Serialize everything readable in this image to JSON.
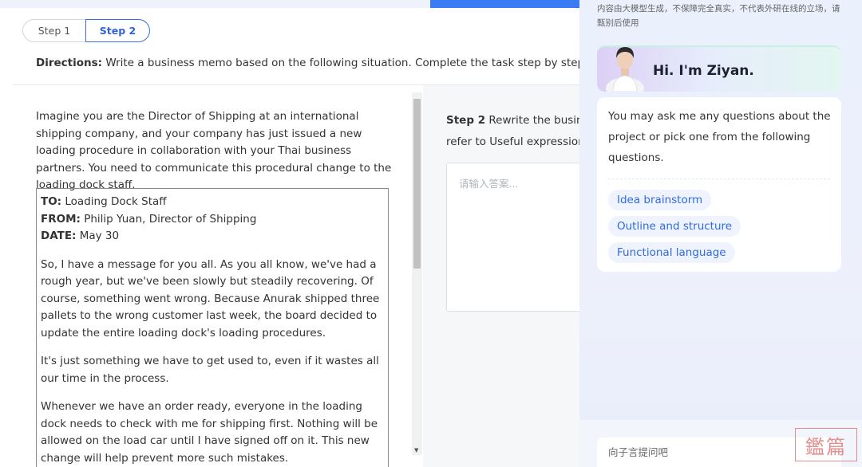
{
  "steps": {
    "tabs": [
      {
        "label": "Step 1"
      },
      {
        "label": "Step 2"
      }
    ]
  },
  "directions": {
    "label": "Directions:",
    "text": "Write a business memo based on the following situation. Complete the task step by step."
  },
  "situation": {
    "intro": "Imagine you are the Director of Shipping at an international shipping company, and your company has just issued a new loading procedure in collaboration with your Thai business partners. You need to communicate this procedural change to the loading dock staff."
  },
  "memo": {
    "to_label": "TO:",
    "to_value": "Loading Dock Staff",
    "from_label": "FROM:",
    "from_value": "Philip Yuan, Director of Shipping",
    "date_label": "DATE:",
    "date_value": "May 30",
    "paragraphs": [
      "So, I have a message for you all. As you all know, we've had a rough year, but we've been slowly but steadily recovering. Of course, something went wrong. Because Anurak shipped three pallets to the wrong customer last week, the board decided to update the entire loading dock's loading procedures.",
      "It's just something we have to get used to, even if it wastes all our time in the process.",
      "Whenever we have an order ready, everyone in the loading dock needs to check with me for shipping first. Nothing will be allowed on the load car until I have signed off on it. This new change will help prevent more such mistakes."
    ]
  },
  "step2": {
    "label": "Step 2",
    "line1": "Rewrite the business",
    "line2": "refer to Useful expressions"
  },
  "answer": {
    "placeholder": "请输入答案..."
  },
  "assistant": {
    "disclaimer": "内容由大模型生成，不保障完全真实，不代表外研在线的立场，请甄别后使用",
    "greeting": "Hi. I'm Ziyan.",
    "message": "You may ask me any questions about the project or pick one from the following questions.",
    "chips": [
      {
        "label": "Idea brainstorm"
      },
      {
        "label": "Outline and structure"
      },
      {
        "label": "Functional language"
      }
    ],
    "input_placeholder": "向子言提问吧",
    "stamp_text": "鑑篇"
  },
  "colors": {
    "accent": "#2f6be6",
    "chip_bg": "#eef3fe",
    "panel_bg": "#eaf1fd"
  }
}
